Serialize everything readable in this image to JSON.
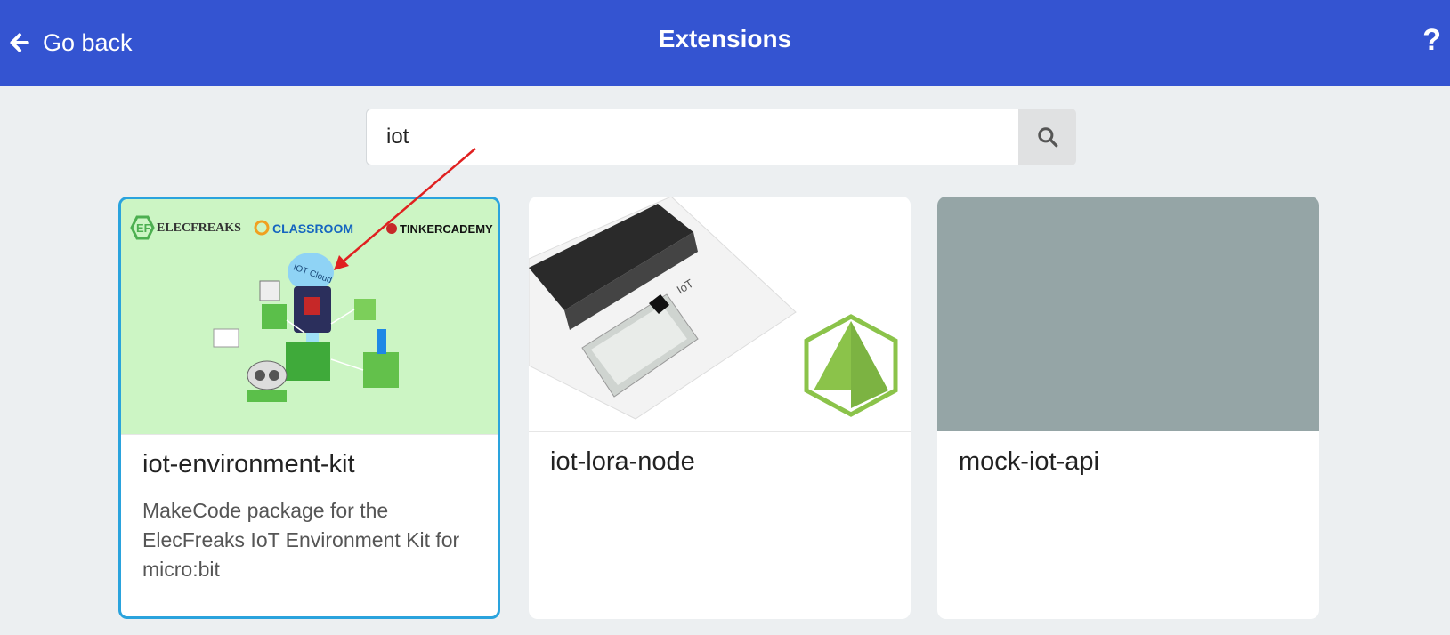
{
  "header": {
    "back_label": "Go back",
    "title": "Extensions",
    "help_label": "?"
  },
  "search": {
    "value": "iot",
    "placeholder": ""
  },
  "cards": [
    {
      "name": "iot-environment-kit",
      "description": "MakeCode package for the ElecFreaks IoT Environment Kit for micro:bit",
      "image_text": {
        "brand1": "ELECFREAKS",
        "brand2": "CLASSROOM",
        "brand3": "TINKERCADEMY",
        "cloud": "IOT Cloud"
      }
    },
    {
      "name": "iot-lora-node",
      "description": "",
      "image_text": {
        "board": "IoT"
      }
    },
    {
      "name": "mock-iot-api",
      "description": ""
    }
  ],
  "colors": {
    "header": "#3454d1",
    "selected_border": "#2aa3dd",
    "placeholder_image": "#95a5a6",
    "annotation_arrow": "#e02020"
  }
}
